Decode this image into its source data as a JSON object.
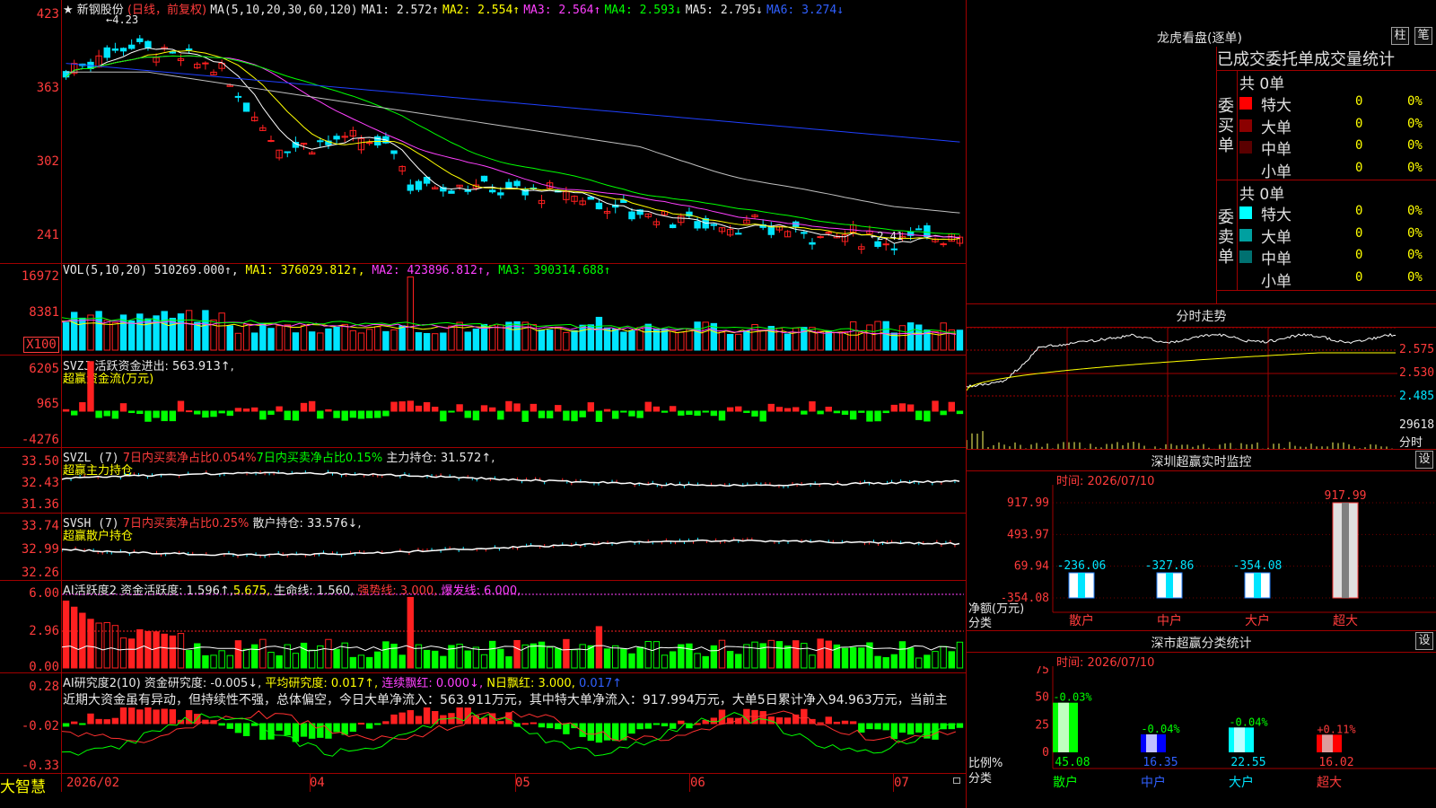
{
  "stock": {
    "star": "★",
    "name": "新钢股份",
    "period": "(日线，前复权)",
    "ma_indicator": "MA(5,10,20,30,60,120)",
    "ma1": "MA1: 2.572↑",
    "ma2": "MA2: 2.554↑",
    "ma3": "MA3: 2.564↑",
    "ma4": "MA4: 2.593↓",
    "ma5": "MA5: 2.795↓",
    "ma6": "MA6: 3.274↓",
    "high_marker": "←4.23",
    "low_marker": "←2.41"
  },
  "price_axis": [
    "423",
    "363",
    "302",
    "241"
  ],
  "vol": {
    "label": "VOL(5,10,20)",
    "value": "510269.000↑,",
    "ma1": "MA1: 376029.812↑,",
    "ma2": "MA2: 423896.812↑,",
    "ma3": "MA3: 390314.688↑",
    "axis": [
      "16972",
      "8381",
      "X100"
    ]
  },
  "svzj": {
    "label": "SVZJ",
    "text": "活跃资金进出: 563.913↑,",
    "sub": "超赢资金流(万元)",
    "axis": [
      "6205",
      "965",
      "-4276"
    ]
  },
  "svzl": {
    "label": "SVZL (7)",
    "t1": "7日内买卖净占比0.054%",
    "t2": "7日内买卖净占比0.15%",
    "t3": "主力持仓: 31.572↑,",
    "sub": "超赢主力持仓",
    "axis": [
      "33.50",
      "32.43",
      "31.36"
    ]
  },
  "svsh": {
    "label": "SVSH (7)",
    "t1": "7日内买卖净占比0.25%",
    "t2": "散户持仓: 33.576↓,",
    "sub": "超赢散户持仓",
    "axis": [
      "33.74",
      "32.99",
      "32.26"
    ]
  },
  "ai_active": {
    "label": "AI活跃度2",
    "t1": "资金活跃度: 1.596↑,",
    "t2": "5.675,",
    "t3": "生命线: 1.560,",
    "t4": "强势线: 3.000,",
    "t5": "爆发线: 6.000,",
    "axis": [
      "6.00",
      "2.96",
      "0.00"
    ]
  },
  "ai_research": {
    "label": "AI研究度2(10)",
    "t1": "资金研究度: -0.005↓,",
    "t2": "平均研究度: 0.017↑,",
    "t3": "连续飘红: 0.000↓,",
    "t4": "N日飘红: 3.000,",
    "t5": "0.017↑",
    "comment": "近期大资金虽有异动，但持续性不强，总体偏空，今日大单净流入：563.911万元，其中特大单净流入：917.994万元，大单5日累计净入94.963万元，当前主",
    "axis": [
      "0.28",
      "-0.02",
      "-0.33"
    ]
  },
  "date_axis": [
    "2026/02",
    "04",
    "05",
    "06",
    "07"
  ],
  "brand": "大智慧",
  "dragon": {
    "title": "龙虎看盘(逐单)",
    "btn1": "柱",
    "btn2": "笔",
    "tabs": "已成交委托单成交量统计",
    "buy_label": "委买单",
    "sell_label": "委卖单",
    "buy_total": "共 0单",
    "sell_total": "共 0单",
    "buy_rows": [
      {
        "name": "特大",
        "count": "0",
        "pct": "0%"
      },
      {
        "name": "大单",
        "count": "0",
        "pct": "0%"
      },
      {
        "name": "中单",
        "count": "0",
        "pct": "0%"
      },
      {
        "name": "小单",
        "count": "0",
        "pct": "0%"
      }
    ],
    "sell_rows": [
      {
        "name": "特大",
        "count": "0",
        "pct": "0%"
      },
      {
        "name": "大单",
        "count": "0",
        "pct": "0%"
      },
      {
        "name": "中单",
        "count": "0",
        "pct": "0%"
      },
      {
        "name": "小单",
        "count": "0",
        "pct": "0%"
      }
    ],
    "buy_colors": [
      "#ff0000",
      "#8b0000",
      "#5a0000",
      "#000000"
    ],
    "sell_colors": [
      "#00ffff",
      "#00a0a0",
      "#007070",
      "#000000"
    ]
  },
  "intraday": {
    "title": "分时走势",
    "axis": [
      "2.575",
      "2.530",
      "2.485"
    ],
    "vol_label": "29618",
    "vol_unit": "分时"
  },
  "sz_monitor": {
    "title": "深圳超赢实时监控",
    "btn": "设",
    "time": "时间: 2026/07/10",
    "axis": [
      "917.99",
      "493.97",
      "69.94",
      "-354.08"
    ],
    "ylabel": "净额(万元)",
    "xlabel": "分类",
    "categories": [
      "散户",
      "中户",
      "大户",
      "超大"
    ],
    "values": [
      -236.06,
      -327.86,
      -354.08,
      917.99
    ],
    "value_labels": [
      "-236.06",
      "-327.86",
      "-354.08",
      "917.99"
    ]
  },
  "sz_classify": {
    "title": "深市超赢分类统计",
    "btn": "设",
    "time": "时间: 2026/07/10",
    "axis": [
      "75",
      "50",
      "25",
      "0"
    ],
    "ylabel": "比例%",
    "xlabel": "分类",
    "categories": [
      "散户",
      "中户",
      "大户",
      "超大"
    ],
    "values": [
      45.08,
      16.35,
      22.55,
      16.02
    ],
    "value_labels": [
      "45.08",
      "16.35",
      "22.55",
      "16.02"
    ],
    "change_labels": [
      "-0.03%",
      "-0.04%",
      "-0.04%",
      "+0.11%"
    ],
    "colors": [
      "#00ff00",
      "#0000ff",
      "#00ffff",
      "#ff0000"
    ]
  },
  "chart_data": [
    {
      "type": "bar",
      "title": "深圳超赢实时监控",
      "ylabel": "净额(万元)",
      "xlabel": "分类",
      "categories": [
        "散户",
        "中户",
        "大户",
        "超大"
      ],
      "values": [
        -236.06,
        -327.86,
        -354.08,
        917.99
      ],
      "ylim": [
        -354.08,
        917.99
      ]
    },
    {
      "type": "bar",
      "title": "深市超赢分类统计",
      "ylabel": "比例%",
      "xlabel": "分类",
      "categories": [
        "散户",
        "中户",
        "大户",
        "超大"
      ],
      "values": [
        45.08,
        16.35,
        22.55,
        16.02
      ],
      "ylim": [
        0,
        75
      ]
    }
  ]
}
